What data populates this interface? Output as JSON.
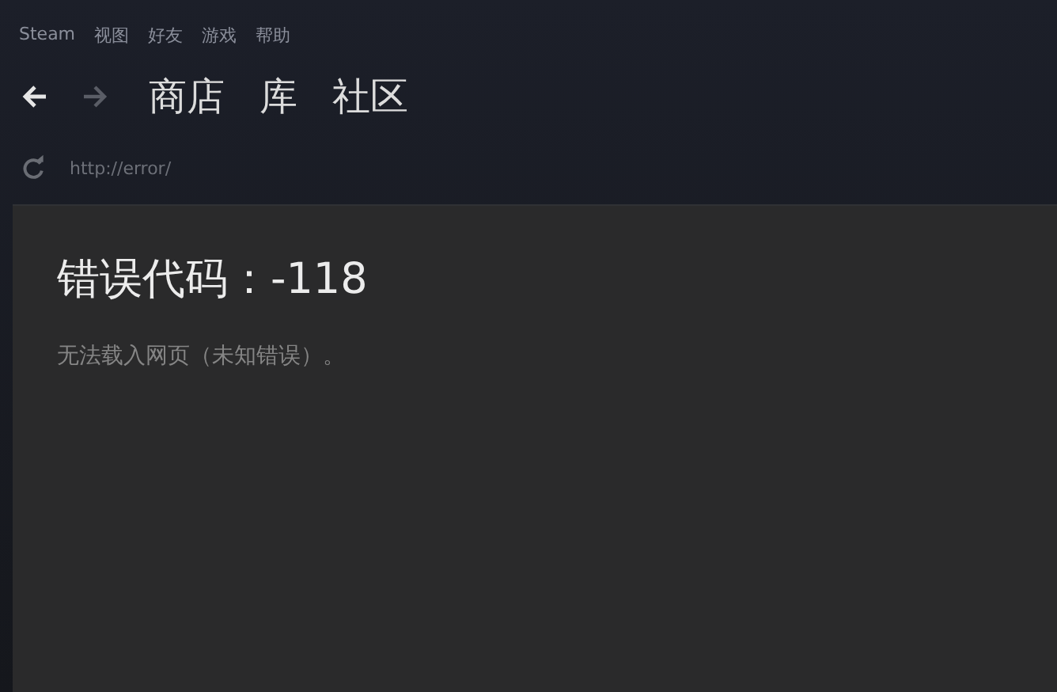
{
  "menu": [
    "Steam",
    "视图",
    "好友",
    "游戏",
    "帮助"
  ],
  "nav": {
    "tabs": [
      "商店",
      "库",
      "社区"
    ]
  },
  "address": {
    "url": "http://error/"
  },
  "error": {
    "title": "错误代码：-118",
    "message": "无法载入网页（未知错误）。"
  }
}
